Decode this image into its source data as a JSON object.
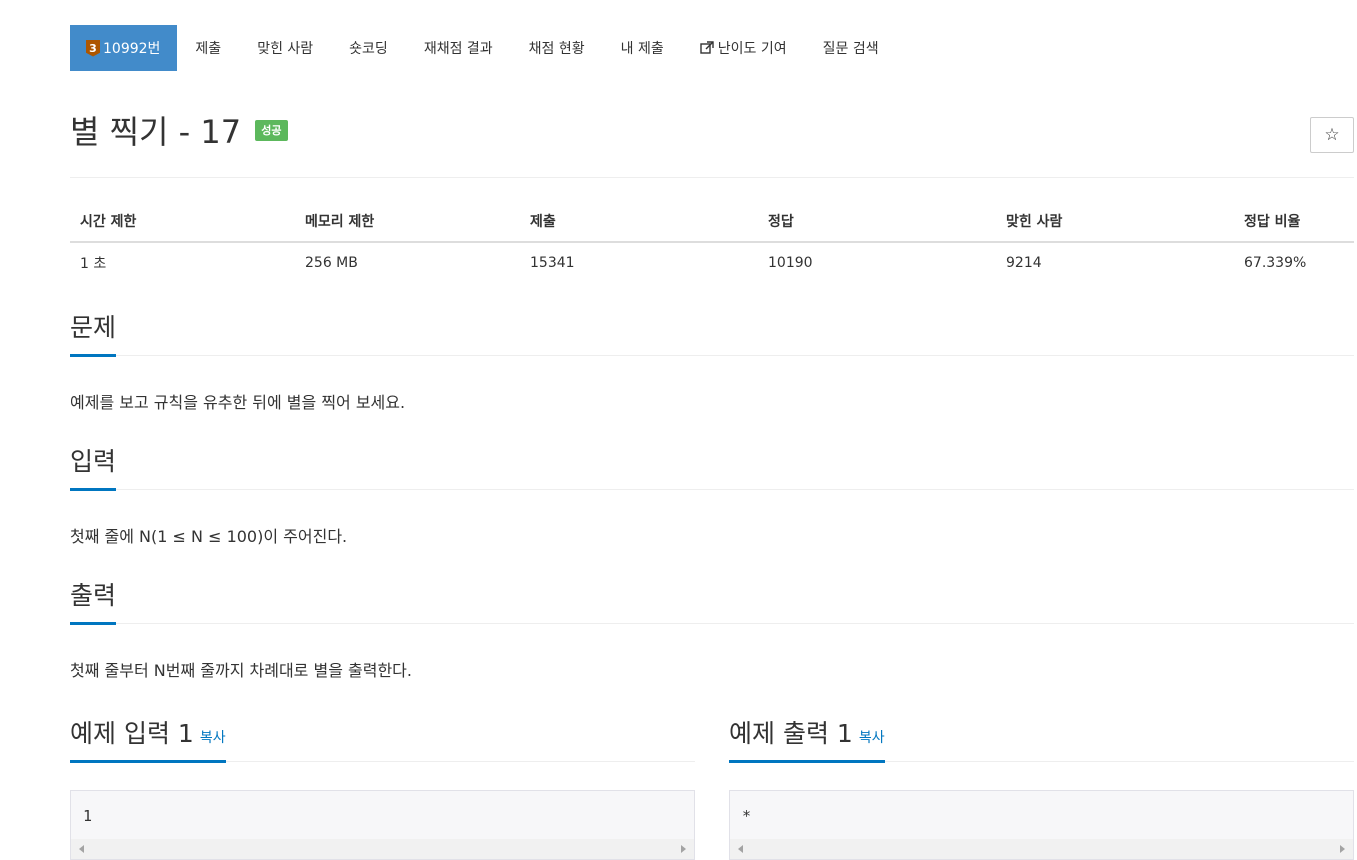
{
  "nav": {
    "problem_tier": "3",
    "problem_number_label": "10992번",
    "items": [
      "제출",
      "맞힌 사람",
      "숏코딩",
      "재채점 결과",
      "채점 현황",
      "내 제출",
      "난이도 기여",
      "질문 검색"
    ]
  },
  "title": {
    "text": "별 찍기 - 17",
    "status": "성공",
    "star_icon": "☆"
  },
  "info_table": {
    "headers": [
      "시간 제한",
      "메모리 제한",
      "제출",
      "정답",
      "맞힌 사람",
      "정답 비율"
    ],
    "values": [
      "1 초",
      "256 MB",
      "15341",
      "10190",
      "9214",
      "67.339%"
    ]
  },
  "sections": {
    "problem": {
      "title": "문제",
      "text": "예제를 보고 규칙을 유추한 뒤에 별을 찍어 보세요."
    },
    "input": {
      "title": "입력",
      "text": "첫째 줄에 N(1 ≤ N ≤ 100)이 주어진다."
    },
    "output": {
      "title": "출력",
      "text": "첫째 줄부터 N번째 줄까지 차례대로 별을 출력한다."
    }
  },
  "examples": {
    "input": {
      "title": "예제 입력 1",
      "copy": "복사",
      "content": "1"
    },
    "output": {
      "title": "예제 출력 1",
      "copy": "복사",
      "content": "*"
    }
  },
  "colors": {
    "nav_active": "#428bca",
    "tier_badge": "#ad5600",
    "status_badge": "#5cb85c",
    "section_underline": "#0076c0"
  }
}
